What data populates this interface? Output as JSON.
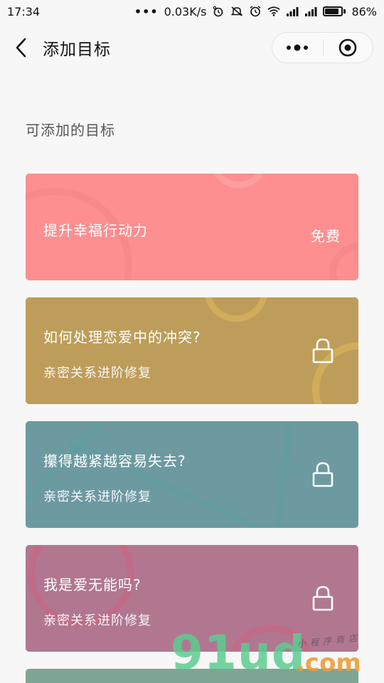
{
  "status_bar": {
    "time": "17:34",
    "dots": "•••",
    "network_speed": "0.03K/s",
    "battery_percent": "86%",
    "battery_level": 0.86,
    "icons": [
      "alarm-icon",
      "mute-icon",
      "clock-icon",
      "wifi-icon",
      "signal-icon",
      "signal-icon",
      "battery-icon"
    ]
  },
  "nav_bar": {
    "title": "添加目标",
    "back_icon": "chevron-left-icon",
    "more_icon": "more-dots-icon",
    "close_icon": "target-close-icon"
  },
  "section": {
    "title": "可添加的目标"
  },
  "goals": [
    {
      "title": "提升幸福行动力",
      "subtitle": "",
      "badge": "免费",
      "locked": false,
      "color": "#fd8f90"
    },
    {
      "title": "如何处理恋爱中的冲突?",
      "subtitle": "亲密关系进阶修复",
      "badge": "",
      "locked": true,
      "color": "#bd9d59"
    },
    {
      "title": "攥得越紧越容易失去?",
      "subtitle": "亲密关系进阶修复",
      "badge": "",
      "locked": true,
      "color": "#6c9aa0"
    },
    {
      "title": "我是爱无能吗?",
      "subtitle": "亲密关系进阶修复",
      "badge": "",
      "locked": true,
      "color": "#b17791"
    },
    {
      "title": "",
      "subtitle": "",
      "badge": "",
      "locked": true,
      "color": "#7ea593"
    }
  ],
  "watermark": {
    "main": "91ud",
    "dotcom": ".com",
    "tagline": "小程序商店"
  }
}
